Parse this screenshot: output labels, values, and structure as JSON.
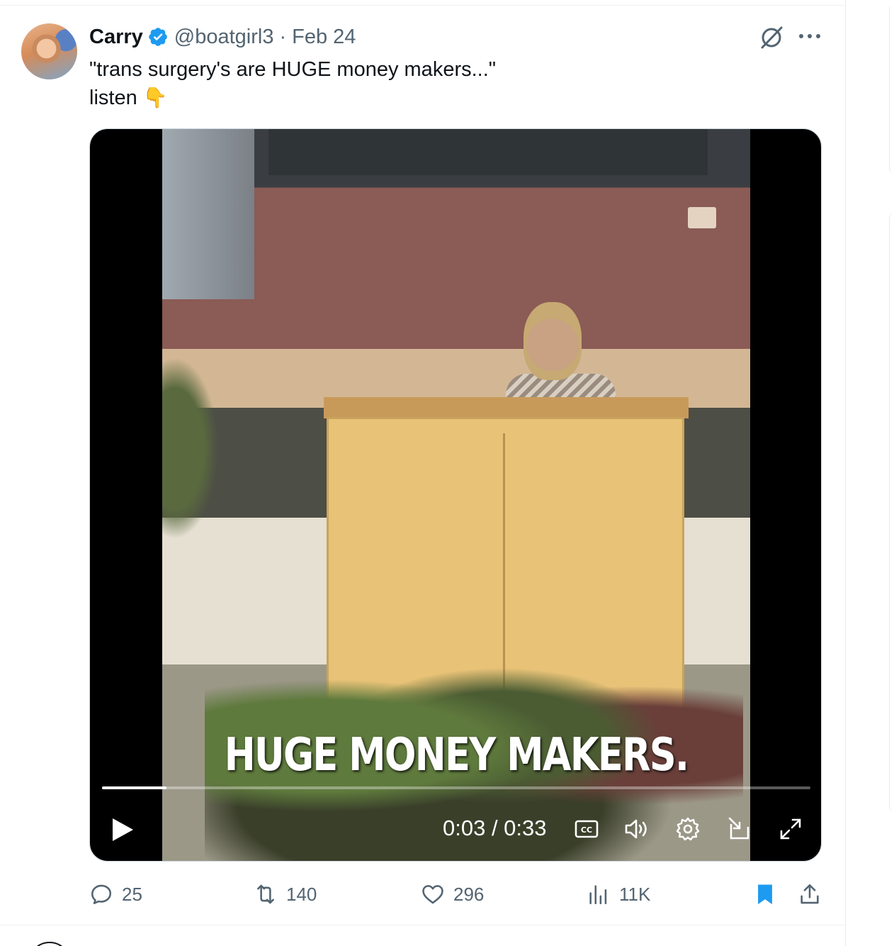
{
  "tweet": {
    "author_name": "Carry",
    "handle": "@boatgirl3",
    "separator": "·",
    "date": "Feb 24",
    "text_line1": "\"trans surgery's are HUGE money makers...\"",
    "text_line2": "listen",
    "emoji": "👇"
  },
  "video": {
    "caption": "HUGE MONEY MAKERS.",
    "time_display": "0:03 / 0:33",
    "progress_fraction": 0.0909,
    "controls": [
      "play-icon",
      "captions-icon",
      "volume-icon",
      "settings-icon",
      "pop-out-icon",
      "fullscreen-icon"
    ]
  },
  "metrics": {
    "replies": "25",
    "retweets": "140",
    "likes": "296",
    "views": "11K"
  },
  "colors": {
    "verified_blue": "#1d9bf0",
    "secondary_text": "#536471",
    "bookmark_active": "#1d9bf0"
  },
  "icons": [
    "verified-badge-icon",
    "grok-icon",
    "more-icon",
    "reply-icon",
    "retweet-icon",
    "like-icon",
    "views-icon",
    "bookmark-icon",
    "share-icon"
  ]
}
